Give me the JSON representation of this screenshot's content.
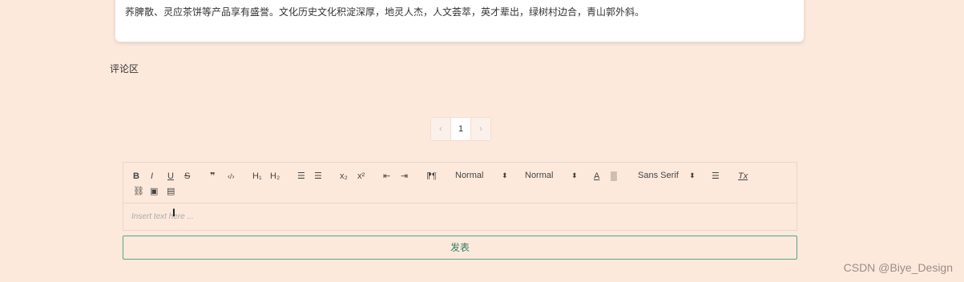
{
  "article": {
    "text": "荞脾散、灵应茶饼等产品享有盛誉。文化历史文化积淀深厚，地灵人杰，人文荟萃，英才辈出，绿树村边合，青山郭外斜。"
  },
  "comments": {
    "label": "评论区"
  },
  "pagination": {
    "prev": "‹",
    "page": "1",
    "next": "›"
  },
  "editor": {
    "toolbar": {
      "bold": "B",
      "italic": "I",
      "underline": "U",
      "strike": "S",
      "blockquote": "❞",
      "code": "‹/›",
      "h1": "H₁",
      "h2": "H₂",
      "ordered_list": "☰",
      "bullet_list": "☰",
      "subscript": "x₂",
      "superscript": "x²",
      "outdent": "⇤",
      "indent": "⇥",
      "direction": "⁋¶",
      "size_select": "Normal",
      "header_select": "Normal",
      "font_color": "A",
      "background_color": "▒",
      "font_select": "Sans Serif",
      "align": "☰",
      "clean": "Tx",
      "link": "⛓",
      "image": "▣",
      "video": "▤"
    },
    "placeholder": "Insert text here ..."
  },
  "submit": {
    "label": "发表"
  },
  "watermark": "CSDN @Biye_Design"
}
